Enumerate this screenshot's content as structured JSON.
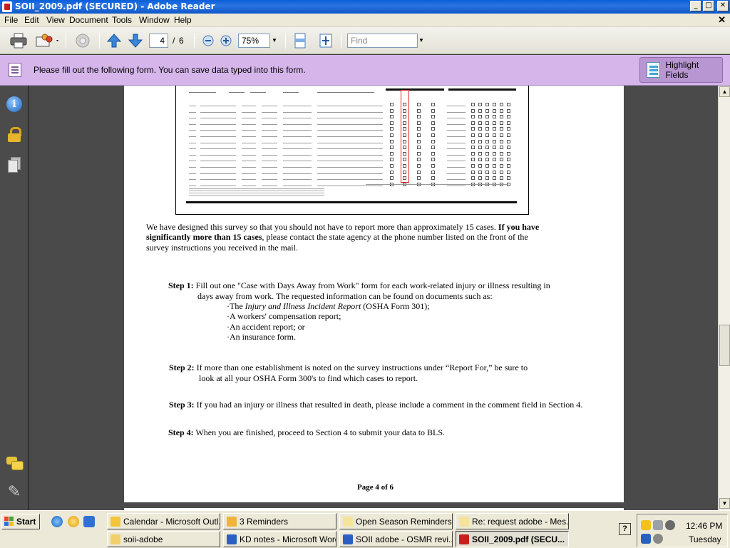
{
  "window": {
    "title": "SOII_2009.pdf (SECURED) - Adobe Reader",
    "min": "_",
    "max": "□",
    "close": "✕"
  },
  "menu": {
    "items": [
      "File",
      "Edit",
      "View",
      "Document",
      "Tools",
      "Window",
      "Help"
    ],
    "doc_close": "✕"
  },
  "toolbar": {
    "page_current": "4",
    "page_sep": "/",
    "page_total": "6",
    "zoom": "75%",
    "find_placeholder": "Find"
  },
  "form_bar": {
    "message": "Please fill out the following form. You can save data typed into this form.",
    "highlight_label": "Highlight Fields"
  },
  "document": {
    "intro_1a": "We have designed this survey so that you should not have to report more than approximately 15 cases. ",
    "intro_1b": "If you have",
    "intro_2a": "significantly more than 15 cases",
    "intro_2b": ", please contact the state agency at the phone number listed on the front of the",
    "intro_3": "survey instructions you received in the mail.",
    "step1_label": "Step 1:",
    "step1_line1": " Fill out one \"Case with Days Away from Work\" form for each work-related injury or illness resulting in",
    "step1_line2": "days away from work. The requested information can be found on documents such as:",
    "step1_b1a": "·The ",
    "step1_b1b": "Injury and Illness Incident Report",
    "step1_b1c": " (OSHA Form 301);",
    "step1_b2": "·A workers' compensation report;",
    "step1_b3": "·An accident report; or",
    "step1_b4": "·An insurance form.",
    "step2_label": "Step 2:",
    "step2_line1": " If more than one establishment is noted on the survey instructions under “Report For,” be sure to",
    "step2_line2": "look at all your OSHA Form 300's to find which cases to report.",
    "step3_label": "Step 3:",
    "step3_text": "  If you had an injury or illness that resulted in death, please include a comment in the comment field in Section 4.",
    "step4_label": "Step 4:",
    "step4_text": "  When you are finished, proceed to Section 4 to submit your data to BLS.",
    "page_footer": "Page 4 of 6"
  },
  "taskbar": {
    "start": "Start",
    "tasks": [
      "Calendar - Microsoft Outl...",
      "3 Reminders",
      "Open Season Reminders...",
      "Re: request adobe - Mes...",
      "soii-adobe",
      "KD notes - Microsoft Word",
      "SOII adobe - OSMR revi...",
      "SOII_2009.pdf (SECU..."
    ],
    "help": "?",
    "clock": "12:46 PM",
    "day": "Tuesday"
  },
  "colors": {
    "titlebar": "#0a5fd8",
    "form_bar": "#d5b5ea",
    "doc_bg": "#4a4a4a",
    "acrobat_red": "#c81e1e"
  }
}
